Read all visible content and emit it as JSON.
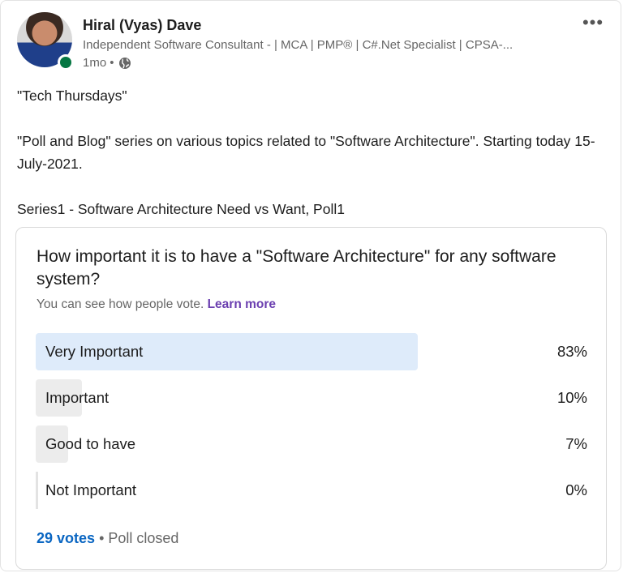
{
  "author": {
    "name": "Hiral (Vyas) Dave",
    "headline": "Independent Software Consultant - | MCA | PMP® | C#.Net Specialist | CPSA-...",
    "time": "1mo",
    "separator": "•",
    "visibility_icon": "globe-icon"
  },
  "post": {
    "lines": [
      "\"Tech Thursdays\"",
      "\"Poll and Blog\" series on various topics related to \"Software Architecture\". Starting today 15-July-2021.",
      "Series1 - Software Architecture Need vs Want, Poll1"
    ]
  },
  "poll": {
    "question": "How important it is to have a \"Software Architecture\" for any software system?",
    "visibility_text": "You can see how people vote.",
    "learn_more": "Learn more",
    "options": [
      {
        "label": "Very Important",
        "percent_text": "83%",
        "percent": 83
      },
      {
        "label": "Important",
        "percent_text": "10%",
        "percent": 10
      },
      {
        "label": "Good to have",
        "percent_text": "7%",
        "percent": 7
      },
      {
        "label": "Not Important",
        "percent_text": "0%",
        "percent": 0
      }
    ],
    "votes": "29 votes",
    "separator": "•",
    "status": "Poll closed"
  },
  "colors": {
    "winner_fill": "#deebfa",
    "option_fill": "#ececec",
    "link_blue": "#0a66c2",
    "learn_more_purple": "#6b3fb0",
    "presence_green": "#057642"
  }
}
